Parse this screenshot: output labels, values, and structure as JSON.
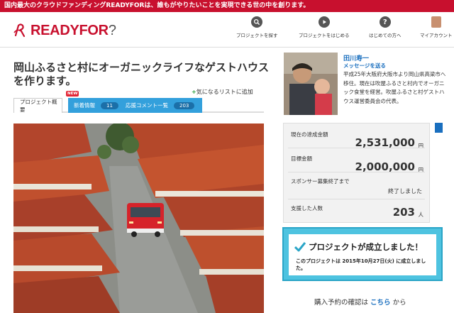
{
  "topbar": {
    "text": "国内最大のクラウドファンディングREADYFORは、誰もがやりたいことを実現できる世の中を創ります。"
  },
  "logo": {
    "name": "READYFOR",
    "suffix": "?"
  },
  "nav": [
    {
      "label": "プロジェクトを探す",
      "icon": "search-icon"
    },
    {
      "label": "プロジェクトをはじめる",
      "icon": "play-icon"
    },
    {
      "label": "はじめての方へ",
      "icon": "question-icon"
    },
    {
      "label": "マイアカウント",
      "icon": "avatar"
    }
  ],
  "project": {
    "title": "岡山ふるさと村にオーガニックライフなゲストハウスを作ります。",
    "favorite_label": "気になるリストに追加"
  },
  "tabs": [
    {
      "label": "プロジェクト概要"
    },
    {
      "label": "新着情報",
      "count": "11",
      "tag": "NEW"
    },
    {
      "label": "応援コメント一覧",
      "count": "203"
    }
  ],
  "owner": {
    "name": "田川寿一",
    "message_link": "メッセージを送る",
    "description": "平成25年大阪府大阪市より岡山県高梁市へ移住。現在は吹屋ふるさと村内でオーガニック食堂を経営。吹屋ふるさと村ゲストハウス運営委員会の代表。"
  },
  "stats": {
    "raised_label": "現在の達成金額",
    "raised_value": "2,531,000",
    "goal_label": "目標金額",
    "goal_value": "2,000,000",
    "currency": "円",
    "deadline_label": "スポンサー募集終了まで",
    "deadline_value": "終了しました",
    "supporters_label": "支援した人数",
    "supporters_value": "203",
    "supporters_unit": "人"
  },
  "success": {
    "heading": "プロジェクトが成立しました！",
    "body": "このプロジェクトは 2015年10月27日(火) に成立しました。"
  },
  "confirm": {
    "prefix": "購入予約の確認は",
    "link": "こちら",
    "suffix": "から"
  },
  "colors": {
    "brand_red": "#c8102e",
    "tab_blue": "#33a0dc",
    "success_cyan": "#4ec3e0",
    "link_blue": "#1a6fbf"
  }
}
